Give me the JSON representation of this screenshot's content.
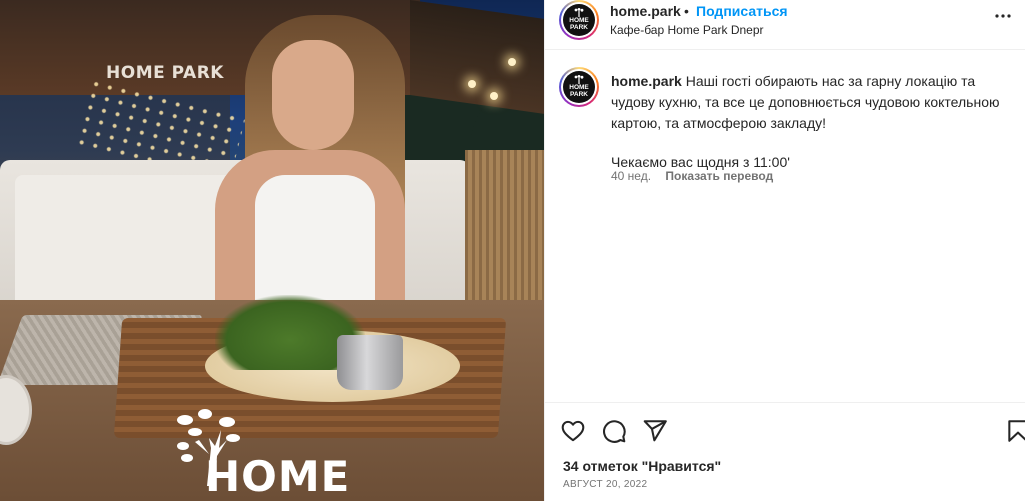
{
  "post": {
    "image_alt": "",
    "photo_sign": "HOME PARK",
    "photo_logo": "HOME"
  },
  "header": {
    "username": "home.park",
    "separator": "•",
    "follow_label": "Подписаться",
    "location": "Кафе-бар Home Park Dnepr",
    "avatar_text_line1": "HOME",
    "avatar_text_line2": "PARK"
  },
  "caption": {
    "username": "home.park",
    "text": "Наші гості обирають нас за гарну локацію та чудову кухню, та все це доповнюється чудовою коктельною картою, та атмосферою закладу!",
    "text2": "Чекаємо вас щодня з 11:00'",
    "time_ago": "40 нед.",
    "translate_label": "Показать перевод"
  },
  "actions": {
    "icons": [
      "heart-icon",
      "comment-icon",
      "share-icon",
      "bookmark-icon"
    ]
  },
  "footer": {
    "likes": "34 отметок \"Нравится\"",
    "date": "АВГУСТ 20, 2022"
  },
  "colors": {
    "link": "#0095f6",
    "text": "#262626",
    "muted": "#737373",
    "border": "#efefef"
  }
}
